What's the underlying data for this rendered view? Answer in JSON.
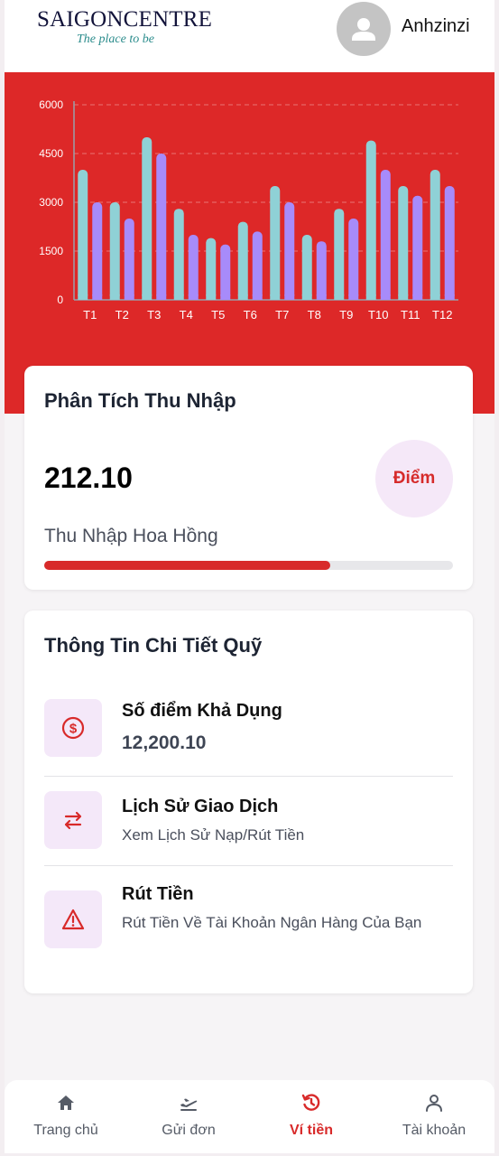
{
  "header": {
    "logo_saigon": "SAIGON",
    "logo_centre": "CENTRE",
    "logo_tagline": "The place to be",
    "username": "Anhzinzi"
  },
  "chart_data": {
    "type": "bar",
    "categories": [
      "T1",
      "T2",
      "T3",
      "T4",
      "T5",
      "T6",
      "T7",
      "T8",
      "T9",
      "T10",
      "T11",
      "T12"
    ],
    "series": [
      {
        "values": [
          4000,
          3000,
          5000,
          2800,
          1900,
          2400,
          3500,
          2000,
          2800,
          4900,
          3500,
          4000
        ],
        "color": "#8fd1d6"
      },
      {
        "values": [
          3000,
          2500,
          4500,
          2000,
          1700,
          2100,
          3000,
          1800,
          2500,
          4000,
          3200,
          3500
        ],
        "color": "#a78bfa"
      }
    ],
    "yticks": [
      0,
      1500,
      3000,
      4500,
      6000
    ],
    "ylim": [
      0,
      6000
    ],
    "grid": true
  },
  "income_card": {
    "title": "Phân Tích Thu Nhập",
    "value": "212.10",
    "badge": "Điểm",
    "label": "Thu Nhập Hoa Hồng",
    "progress": 0.7
  },
  "fund_card": {
    "title": "Thông Tin Chi Tiết Quỹ",
    "items": [
      {
        "icon": "dollar-circle-icon",
        "title": "Số điểm Khả Dụng",
        "value": "12,200.10"
      },
      {
        "icon": "swap-arrows-icon",
        "title": "Lịch Sử Giao Dịch",
        "sub": "Xem Lịch Sử Nạp/Rút Tiền"
      },
      {
        "icon": "warning-triangle-icon",
        "title": "Rút Tiền",
        "sub": "Rút Tiền Về Tài Khoản Ngân Hàng Của Bạn"
      }
    ]
  },
  "bottom_nav": {
    "items": [
      {
        "label": "Trang chủ",
        "icon": "home-icon"
      },
      {
        "label": "Gửi đơn",
        "icon": "plane-icon"
      },
      {
        "label": "Ví tiền",
        "icon": "history-icon",
        "active": true
      },
      {
        "label": "Tài khoản",
        "icon": "user-icon"
      }
    ]
  },
  "colors": {
    "accent": "#d82a2a",
    "chart_bg": "#dd2828",
    "bar_teal": "#8fd1d6",
    "bar_purple": "#a78bfa",
    "icon_bg": "#f4e8f9"
  }
}
